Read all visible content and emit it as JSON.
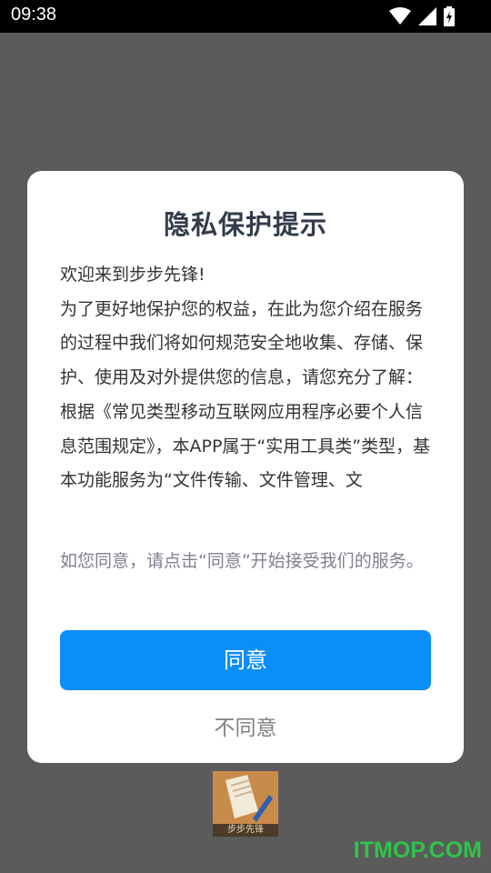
{
  "status_bar": {
    "time": "09:38",
    "icons": [
      "wifi-icon",
      "cell-signal-icon",
      "battery-charging-icon"
    ]
  },
  "dialog": {
    "title": "隐私保护提示",
    "paragraphs": [
      "欢迎来到步步先锋!",
      "为了更好地保护您的权益，在此为您介绍在服务的过程中我们将如何规范安全地收集、存储、保护、使用及对外提供您的信息，请您充分了解：",
      "根据《常见类型移动互联网应用程序必要个人信息范围规定》，本APP属于“实用工具类”类型，基本功能服务为“文件传输、文件管理、文"
    ],
    "hint": "如您同意，请点击“同意”开始接受我们的服务。",
    "agree_label": "同意",
    "disagree_label": "不同意"
  },
  "app_logo": {
    "label": "步步先锋"
  },
  "watermark": "ITMOP.COM",
  "colors": {
    "overlay": "#5b5b5b",
    "accent": "#0a8ef9",
    "title": "#333c4b",
    "hint": "#808090",
    "watermark": "#2fc44a"
  }
}
